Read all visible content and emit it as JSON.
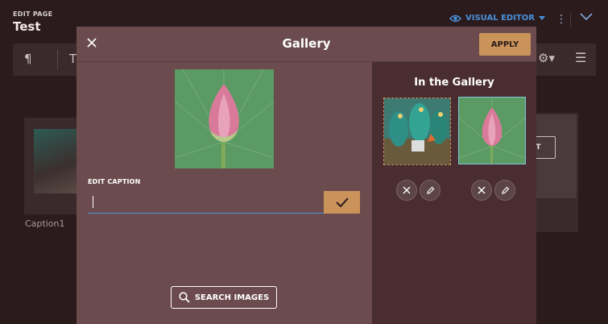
{
  "background": {
    "edit_label": "EDIT PAGE",
    "page_title": "Test",
    "visual_editor_label": "VISUAL EDITOR",
    "caption": "Caption1",
    "partial_button_label": "IT",
    "toolbar": {
      "paragraph_symbol": "¶",
      "text_symbol": "T"
    }
  },
  "modal": {
    "title": "Gallery",
    "apply_label": "APPLY",
    "edit_caption_label": "EDIT CAPTION",
    "caption_value": "",
    "search_images_label": "SEARCH IMAGES",
    "gallery_heading": "In the Gallery",
    "gallery_items": [
      {
        "name": "dragons-illustration",
        "selected": false
      },
      {
        "name": "lotus-bud",
        "selected": true
      }
    ]
  },
  "colors": {
    "modal_bg": "#6b4b4e",
    "right_pane_bg": "#4a2d30",
    "accent": "#c9935a",
    "link_blue": "#4a90d9"
  },
  "icons": [
    "close-icon",
    "check-icon",
    "search-icon",
    "remove-icon",
    "pencil-icon",
    "eye-icon",
    "more-vertical-icon",
    "chevron-down-icon",
    "gear-icon",
    "hamburger-icon"
  ]
}
